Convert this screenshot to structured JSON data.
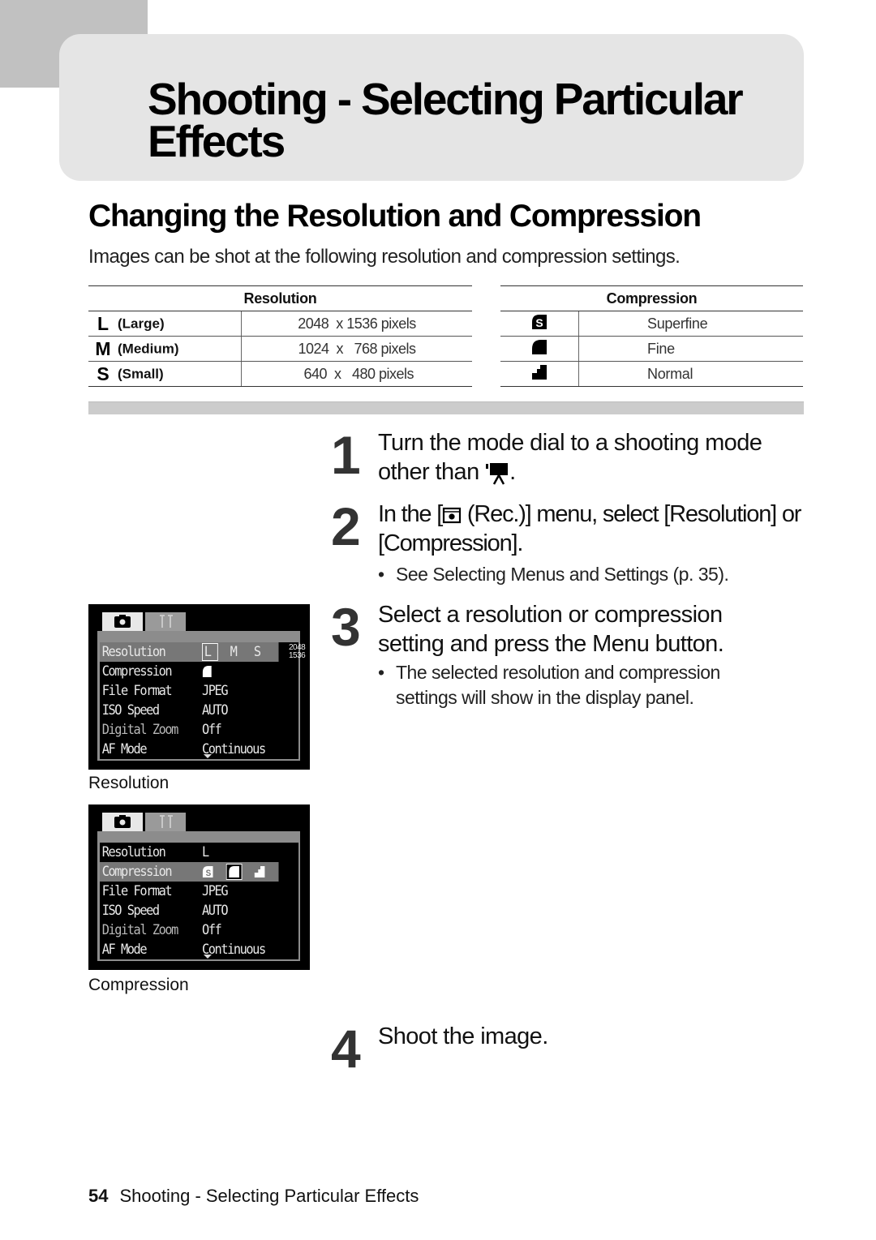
{
  "page": {
    "title": "Shooting - Selecting Particular Effects",
    "section_title": "Changing the Resolution and Compression",
    "intro": "Images can be shot at the following resolution and compression settings."
  },
  "resolution_table": {
    "header": "Resolution",
    "rows": [
      {
        "icon": "L",
        "name": "(Large)",
        "value": "2048  x 1536 pixels"
      },
      {
        "icon": "M",
        "name": "(Medium)",
        "value": "1024  x   768 pixels"
      },
      {
        "icon": "S",
        "name": "(Small)",
        "value": " 640  x   480 pixels"
      }
    ]
  },
  "compression_table": {
    "header": "Compression",
    "rows": [
      {
        "icon": "superfine-icon",
        "value": "Superfine"
      },
      {
        "icon": "fine-icon",
        "value": "Fine"
      },
      {
        "icon": "normal-icon",
        "value": "Normal"
      }
    ]
  },
  "steps": [
    {
      "number": "1",
      "text_before": "Turn the mode dial to a shooting mode other than ",
      "icon": "movie-icon",
      "text_after": "."
    },
    {
      "number": "2",
      "text_before": "In the [",
      "icon": "rec-camera-icon",
      "text_after": " (Rec.)] menu, select [Resolution] or [Compression].",
      "bullets": [
        "See Selecting Menus and Settings (p. 35)."
      ]
    },
    {
      "number": "3",
      "text": "Select a resolution or compression setting and press the Menu button.",
      "bullets": [
        "The selected resolution and compression",
        "settings will show in the display panel."
      ]
    },
    {
      "number": "4",
      "text": "Shoot the image."
    }
  ],
  "lcd_screens": [
    {
      "caption": "Resolution",
      "resolution_size": [
        "2048",
        "1536"
      ],
      "rows": [
        {
          "label": "Resolution",
          "value": "L  M  S",
          "selected": true
        },
        {
          "label": "Compression",
          "value": "fine-icon"
        },
        {
          "label": "File Format",
          "value": "JPEG"
        },
        {
          "label": "ISO Speed",
          "value": "AUTO"
        },
        {
          "label": "Digital Zoom",
          "value": "Off",
          "dimmed": true
        },
        {
          "label": "AF Mode",
          "value": "Continuous"
        }
      ]
    },
    {
      "caption": "Compression",
      "rows": [
        {
          "label": "Resolution",
          "value": "L"
        },
        {
          "label": "Compression",
          "value": "superfine fine normal",
          "selected": true
        },
        {
          "label": "File Format",
          "value": "JPEG"
        },
        {
          "label": "ISO Speed",
          "value": "AUTO"
        },
        {
          "label": "Digital Zoom",
          "value": "Off",
          "dimmed": true
        },
        {
          "label": "AF Mode",
          "value": "Continuous"
        }
      ]
    }
  ],
  "footer": {
    "page_number": "54",
    "chapter": "Shooting - Selecting Particular Effects"
  }
}
